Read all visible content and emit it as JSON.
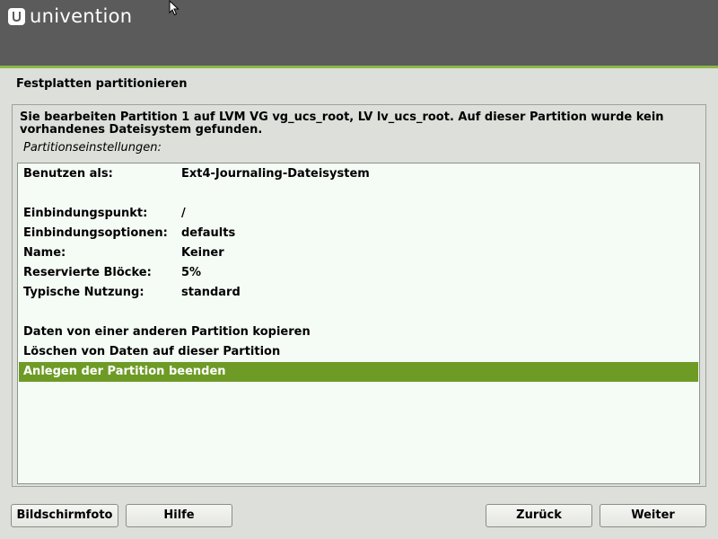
{
  "header": {
    "brand": "univention",
    "logo_icon": "univention-logo-icon",
    "accent_color": "#8bb84a"
  },
  "page": {
    "title": "Festplatten partitionieren"
  },
  "content": {
    "description": "Sie bearbeiten Partition 1 auf LVM VG vg_ucs_root, LV lv_ucs_root. Auf dieser Partition wurde kein vorhandenes Dateisystem gefunden.",
    "settings_label": "Partitionseinstellungen:",
    "rows": [
      {
        "key": "Benutzen als:",
        "value": "Ext4-Journaling-Dateisystem"
      },
      {
        "key": "",
        "value": ""
      },
      {
        "key": "Einbindungspunkt:",
        "value": "/"
      },
      {
        "key": "Einbindungsoptionen:",
        "value": "defaults"
      },
      {
        "key": "Name:",
        "value": "Keiner"
      },
      {
        "key": "Reservierte Blöcke:",
        "value": "5%"
      },
      {
        "key": "Typische Nutzung:",
        "value": "standard"
      },
      {
        "key": "",
        "value": ""
      },
      {
        "key": "Daten von einer anderen Partition kopieren",
        "value": ""
      },
      {
        "key": "Löschen von Daten auf dieser Partition",
        "value": ""
      },
      {
        "key": "Anlegen der Partition beenden",
        "value": ""
      }
    ],
    "selected_color": "#6e9b26"
  },
  "buttons": {
    "screenshot": "Bildschirmfoto",
    "help": "Hilfe",
    "back": "Zurück",
    "next": "Weiter"
  }
}
